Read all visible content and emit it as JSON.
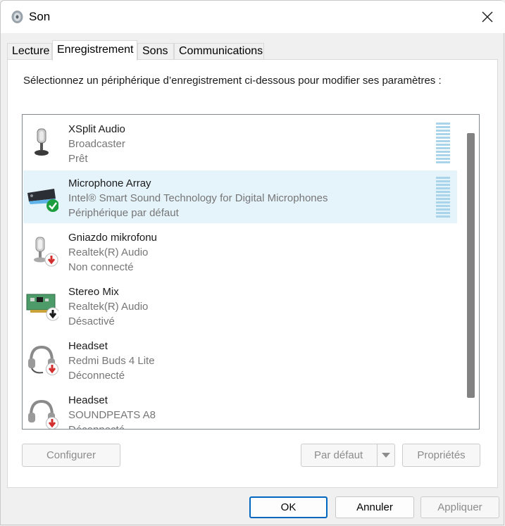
{
  "window": {
    "title": "Son"
  },
  "tabs": [
    {
      "label": "Lecture",
      "active": false
    },
    {
      "label": "Enregistrement",
      "active": true
    },
    {
      "label": "Sons",
      "active": false
    },
    {
      "label": "Communications",
      "active": false
    }
  ],
  "instructions": "Sélectionnez un périphérique d’enregistrement ci-dessous pour modifier ses paramètres :",
  "devices": [
    {
      "name": "XSplit Audio",
      "sub": "Broadcaster",
      "status": "Prêt",
      "icon": "microphone-icon",
      "selected": false
    },
    {
      "name": "Microphone Array",
      "sub": "Intel® Smart Sound Technology for Digital Microphones",
      "status": "Périphérique par défaut",
      "icon": "microphone-array-icon",
      "selected": true
    },
    {
      "name": "Gniazdo mikrofonu",
      "sub": "Realtek(R) Audio",
      "status": "Non connecté",
      "icon": "microphone-icon",
      "selected": false
    },
    {
      "name": "Stereo Mix",
      "sub": "Realtek(R) Audio",
      "status": "Désactivé",
      "icon": "sound-card-icon",
      "selected": false
    },
    {
      "name": "Headset",
      "sub": "Redmi Buds 4 Lite",
      "status": "Déconnecté",
      "icon": "headset-icon",
      "selected": false
    },
    {
      "name": "Headset",
      "sub": "SOUNDPEATS A8",
      "status": "Déconnecté",
      "icon": "headset-icon",
      "selected": false
    }
  ],
  "buttons": {
    "configure": "Configurer",
    "set_default": "Par défaut",
    "properties": "Propriétés",
    "ok": "OK",
    "cancel": "Annuler",
    "apply": "Appliquer"
  },
  "colors": {
    "selected_row": "#e5f3fb",
    "status_ok": "#16a34a",
    "status_unplugged": "#d32f2f",
    "primary_border": "#0067c0"
  }
}
